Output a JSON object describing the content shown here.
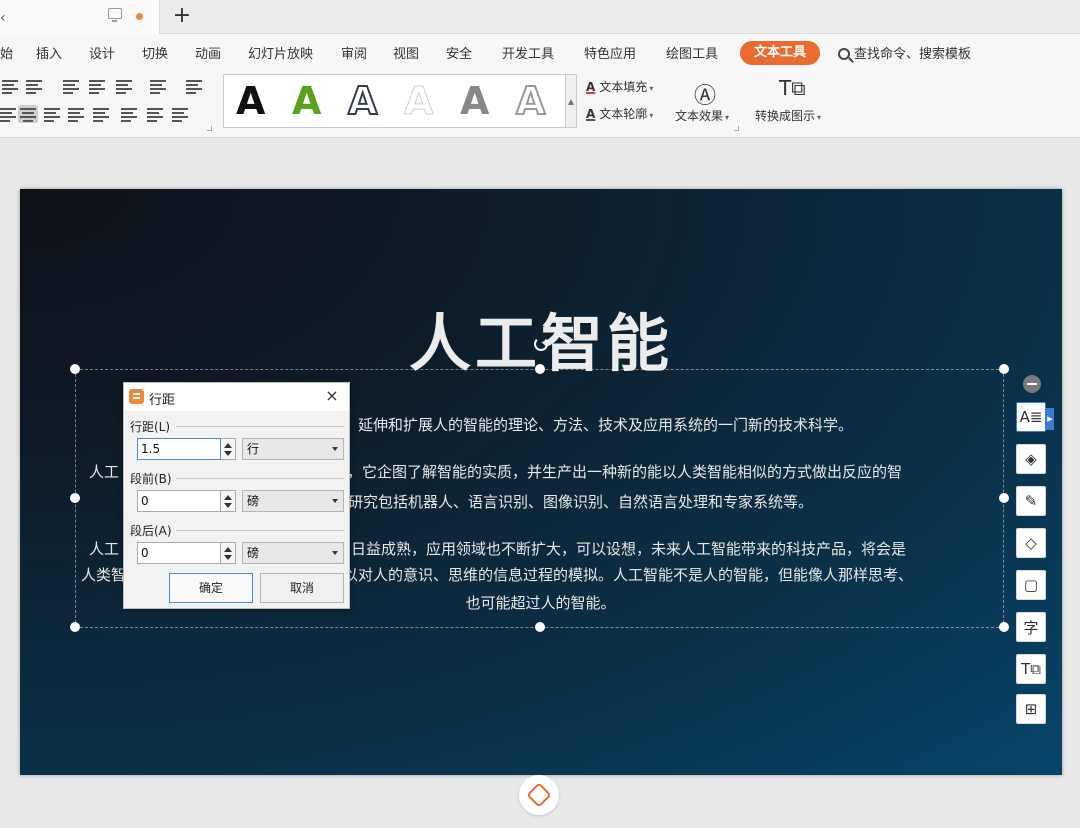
{
  "tabbar": {
    "new_tab": "+"
  },
  "menu": {
    "items": [
      "始",
      "插入",
      "设计",
      "切换",
      "动画",
      "幻灯片放映",
      "审阅",
      "视图",
      "安全",
      "开发工具",
      "特色应用",
      "绘图工具"
    ],
    "active": "文本工具",
    "search": "查找命令、搜索模板"
  },
  "ribbon": {
    "text_fill": "文本填充",
    "text_outline": "文本轮廓",
    "text_effect": "文本效果",
    "convert": "转换成图示",
    "style_letter": "A",
    "style_colors": [
      "#111111",
      "#5aa21c",
      "#2f3d55",
      "#cfcfcf",
      "#888888",
      "#9a9a9a"
    ]
  },
  "slide": {
    "title": "人工智能",
    "lines": [
      "人工智能（Artificial Intelligence），英文缩写为AI。它是研究、开发用于模拟、延伸和扩展人的智能的理论、方法、技术及应用系统的一门新的技术科学。",
      "人工智能是计算机科学的一个分支，它企图了解智能的实质，并生产出一种新的能以人类智能相似的方式做出反应的智",
      "能机器，该领域的研究包括机器人、语言识别、图像识别、自然语言处理和专家系统等。",
      "人工智能从诞生以来，理论和技术日益成熟，应用领域也不断扩大，可以设想，未来人工智能带来的科技产品，将会是",
      "人类智慧的“容器”。人工智能可以对人的意识、思维的信息过程的模拟。人工智能不是人的智能，但能像人那样思考、",
      "也可能超过人的智能。"
    ],
    "visible_lines": [
      "延伸和扩展人的智能的理论、方法、技术及应用系统的一门新的技术科学。",
      "人工",
      "，它企图了解智能的实质，并生产出一种新的能以人类智能相似的方式做出反应的智",
      "研究包括机器人、语言识别、图像识别、自然语言处理和专家系统等。",
      "人工",
      "日益成熟，应用领域也不断扩大，可以设想，未来人工智能带来的科技产品，将会是",
      "人类智",
      "以对人的意识、思维的信息过程的模拟。人工智能不是人的智能，但能像人那样思考、",
      "也可能超过人的智能。"
    ]
  },
  "side_tools": [
    "文本框",
    "图层",
    "画笔",
    "填充",
    "边框",
    "字",
    "转换",
    "更多"
  ],
  "dialog": {
    "title": "行距",
    "close": "×",
    "line_spacing_label": "行距(L)",
    "line_spacing_value": "1.5",
    "line_spacing_unit": "行",
    "before_label": "段前(B)",
    "before_value": "0",
    "before_unit": "磅",
    "after_label": "段后(A)",
    "after_value": "0",
    "after_unit": "磅",
    "ok": "确定",
    "cancel": "取消"
  }
}
